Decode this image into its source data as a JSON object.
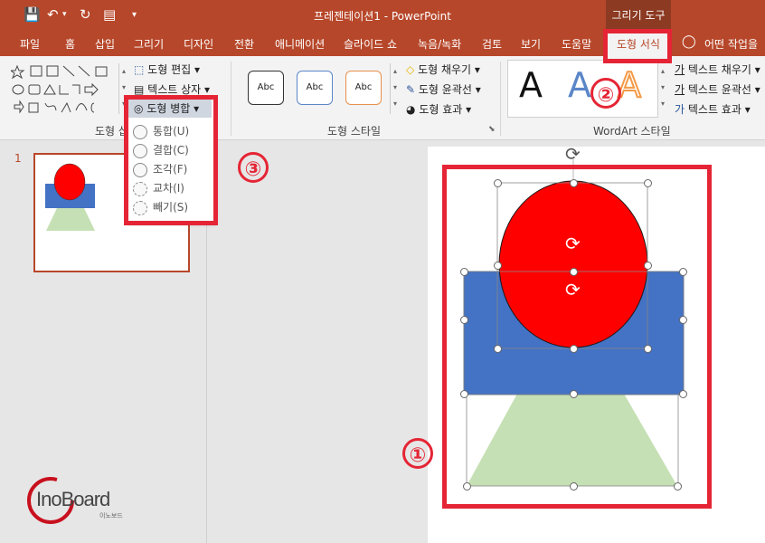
{
  "titlebar": {
    "title": "프레젠테이션1  -  PowerPoint",
    "context_tool": "그리기 도구"
  },
  "tabs": [
    "파일",
    "홈",
    "삽입",
    "그리기",
    "디자인",
    "전환",
    "애니메이션",
    "슬라이드 쇼",
    "녹음/녹화",
    "검토",
    "보기",
    "도움말"
  ],
  "active_tab": "도형 서식",
  "tell_me": "어떤 작업을",
  "ribbon": {
    "insert_shapes": {
      "edit_shape": "도형 편집",
      "text_box": "텍스트 상자",
      "merge_shapes": "도형 병합",
      "label": "도형 삽"
    },
    "shape_styles": {
      "style_sample": "Abc",
      "fill": "도형 채우기",
      "outline": "도형 윤곽선",
      "effects": "도형 효과",
      "label": "도형 스타일"
    },
    "wordart": {
      "text_fill": "텍스트 채우기",
      "text_outline": "텍스트 윤곽선",
      "text_effects": "텍스트 효과",
      "label": "WordArt 스타일",
      "sample_letter": "A"
    }
  },
  "merge_menu": {
    "items": [
      "통합(U)",
      "결합(C)",
      "조각(F)",
      "교차(I)",
      "빼기(S)"
    ]
  },
  "slides_panel": {
    "slide_number": "1"
  },
  "annotations": {
    "one": "①",
    "two": "②",
    "three": "③"
  },
  "logo": {
    "text": "InoBoard",
    "sub": "이노보드"
  },
  "colors": {
    "accent": "#b7472a",
    "highlight": "#e52535",
    "circle": "#ff0000",
    "rectangle": "#4472c4",
    "trapezoid": "#c5e0b4"
  }
}
